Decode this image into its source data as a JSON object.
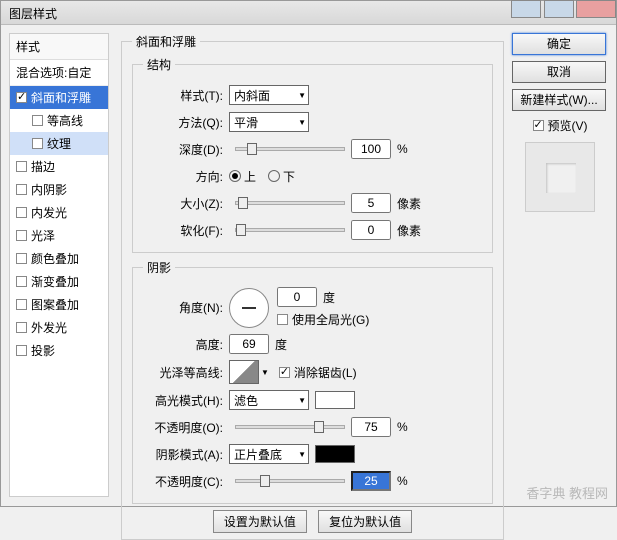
{
  "title": "图层样式",
  "sidebar": {
    "header": "样式",
    "blend": "混合选项:自定",
    "items": [
      {
        "label": "斜面和浮雕",
        "checked": true,
        "selected": true
      },
      {
        "label": "等高线",
        "checked": false,
        "indent": true
      },
      {
        "label": "纹理",
        "checked": false,
        "indent": true,
        "hover": true
      },
      {
        "label": "描边",
        "checked": false
      },
      {
        "label": "内阴影",
        "checked": false
      },
      {
        "label": "内发光",
        "checked": false
      },
      {
        "label": "光泽",
        "checked": false
      },
      {
        "label": "颜色叠加",
        "checked": false
      },
      {
        "label": "渐变叠加",
        "checked": false
      },
      {
        "label": "图案叠加",
        "checked": false
      },
      {
        "label": "外发光",
        "checked": false
      },
      {
        "label": "投影",
        "checked": false
      }
    ]
  },
  "panel": {
    "title": "斜面和浮雕",
    "structure": {
      "legend": "结构",
      "style_label": "样式(T):",
      "style_value": "内斜面",
      "technique_label": "方法(Q):",
      "technique_value": "平滑",
      "depth_label": "深度(D):",
      "depth_value": "100",
      "depth_unit": "%",
      "direction_label": "方向:",
      "dir_up": "上",
      "dir_down": "下",
      "size_label": "大小(Z):",
      "size_value": "5",
      "size_unit": "像素",
      "soften_label": "软化(F):",
      "soften_value": "0",
      "soften_unit": "像素"
    },
    "shading": {
      "legend": "阴影",
      "angle_label": "角度(N):",
      "angle_value": "0",
      "angle_unit": "度",
      "global_label": "使用全局光(G)",
      "altitude_label": "高度:",
      "altitude_value": "69",
      "altitude_unit": "度",
      "gloss_label": "光泽等高线:",
      "antialias_label": "消除锯齿(L)",
      "highlight_mode_label": "高光模式(H):",
      "highlight_mode_value": "滤色",
      "highlight_opacity_label": "不透明度(O):",
      "highlight_opacity_value": "75",
      "highlight_opacity_unit": "%",
      "shadow_mode_label": "阴影模式(A):",
      "shadow_mode_value": "正片叠底",
      "shadow_opacity_label": "不透明度(C):",
      "shadow_opacity_value": "25",
      "shadow_opacity_unit": "%"
    },
    "reset_default": "设置为默认值",
    "revert_default": "复位为默认值"
  },
  "buttons": {
    "ok": "确定",
    "cancel": "取消",
    "new_style": "新建样式(W)...",
    "preview": "预览(V)"
  },
  "watermark": "香字典 教程网"
}
